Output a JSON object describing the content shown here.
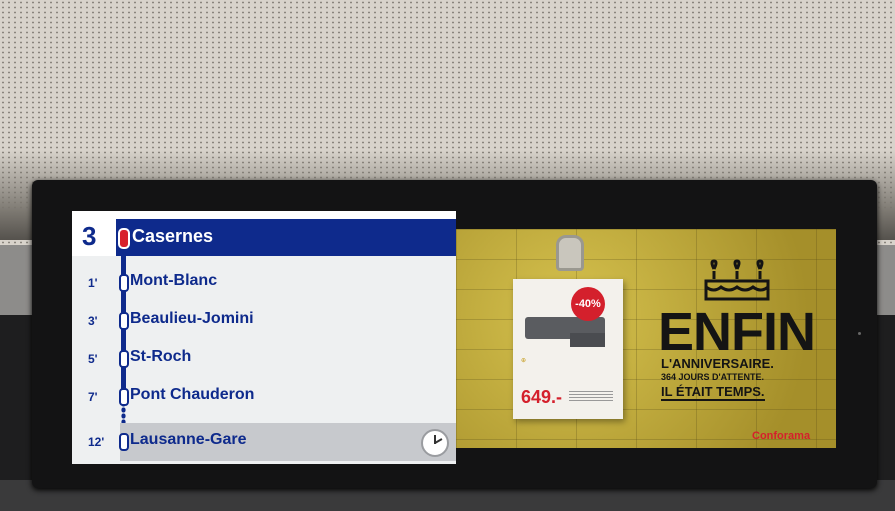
{
  "display": {
    "line_number": "3",
    "destination": "Casernes",
    "stops": [
      {
        "minutes": "1'",
        "name": "Mont-Blanc"
      },
      {
        "minutes": "3'",
        "name": "Beaulieu-Jomini"
      },
      {
        "minutes": "5'",
        "name": "St-Roch"
      },
      {
        "minutes": "7'",
        "name": "Pont Chauderon"
      },
      {
        "minutes": "12'",
        "name": "Lausanne-Gare"
      }
    ],
    "clock_icon": "clock-icon"
  },
  "advertisement": {
    "discount": "-40%",
    "price": "649.-",
    "headline": "ENFIN",
    "line1": "L'ANNIVERSAIRE.",
    "line2": "364 JOURS D'ATTENTE.",
    "line3": "IL ÉTAIT TEMPS.",
    "brand": "Conforama"
  },
  "colors": {
    "line_blue": "#0e2a8c",
    "destination_red": "#d8212c",
    "ad_yellow": "#bba43a"
  }
}
